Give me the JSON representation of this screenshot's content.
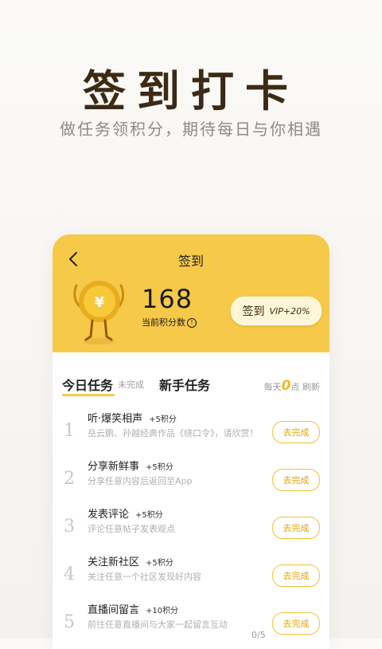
{
  "hero": {
    "title": "签到打卡",
    "subtitle": "做任务领积分，期待每日与你相遇"
  },
  "card": {
    "title": "签到",
    "points": "168",
    "points_label": "当前积分数",
    "info_glyph": "!",
    "checkin_label": "签到",
    "vip_badge": "VIP+20%"
  },
  "tabs": {
    "today": "今日任务",
    "today_status": "未完成",
    "newbie": "新手任务",
    "refresh_prefix": "每天",
    "refresh_zero": "0",
    "refresh_suffix": "点 刷新"
  },
  "tasks": [
    {
      "num": "1",
      "title": "听·爆笑相声",
      "points": "+5积分",
      "desc": "岳云鹏、孙越经典作品《绕口令》，请欣赏！",
      "button": "去完成",
      "progress": ""
    },
    {
      "num": "2",
      "title": "分享新鲜事",
      "points": "+5积分",
      "desc": "分享任意内容后返回至App",
      "button": "去完成",
      "progress": ""
    },
    {
      "num": "3",
      "title": "发表评论",
      "points": "+5积分",
      "desc": "评论任意帖子发表观点",
      "button": "去完成",
      "progress": ""
    },
    {
      "num": "4",
      "title": "关注新社区",
      "points": "+5积分",
      "desc": "关注任意一个社区发现好内容",
      "button": "去完成",
      "progress": ""
    },
    {
      "num": "5",
      "title": "直播间留言",
      "points": "+10积分",
      "desc": "前往任意直播间与大家一起留言互动",
      "button": "去完成",
      "progress": "0/5"
    }
  ],
  "colors": {
    "accent": "#f7c949",
    "button_border": "#f0c233",
    "title_brown": "#3c2a14"
  }
}
